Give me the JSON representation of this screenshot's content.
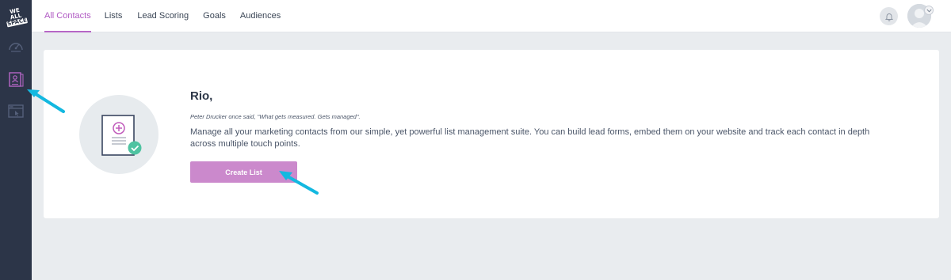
{
  "sidebar": {
    "logo_lines": [
      "WE",
      "ALL",
      "SPACE"
    ],
    "items": [
      {
        "name": "dashboard-gauge",
        "icon": "gauge-icon",
        "active": false
      },
      {
        "name": "contacts",
        "icon": "contact-list-icon",
        "active": true
      },
      {
        "name": "pages",
        "icon": "browser-cursor-icon",
        "active": false
      }
    ]
  },
  "topbar": {
    "tabs": [
      {
        "label": "All Contacts",
        "active": true
      },
      {
        "label": "Lists",
        "active": false
      },
      {
        "label": "Lead Scoring",
        "active": false
      },
      {
        "label": "Goals",
        "active": false
      },
      {
        "label": "Audiences",
        "active": false
      }
    ],
    "notification_icon": "bell-icon",
    "avatar_icon": "user-avatar-icon"
  },
  "main": {
    "greeting": "Rio,",
    "quote": "Peter Drucker once said, \"What gets measured. Gets managed\".",
    "description": "Manage all your marketing contacts from our simple, yet powerful list management suite. You can build lead forms, embed them on your website and track each contact in depth across multiple touch points.",
    "create_button_label": "Create List",
    "illustration_icon": "document-add-check-icon"
  },
  "colors": {
    "sidebar_bg": "#2c3548",
    "accent": "#b666c6",
    "button_bg": "#cb89cc",
    "check_green": "#4fc3a1",
    "annotation_arrow": "#13b8e0",
    "page_bg": "#e9ecef"
  }
}
